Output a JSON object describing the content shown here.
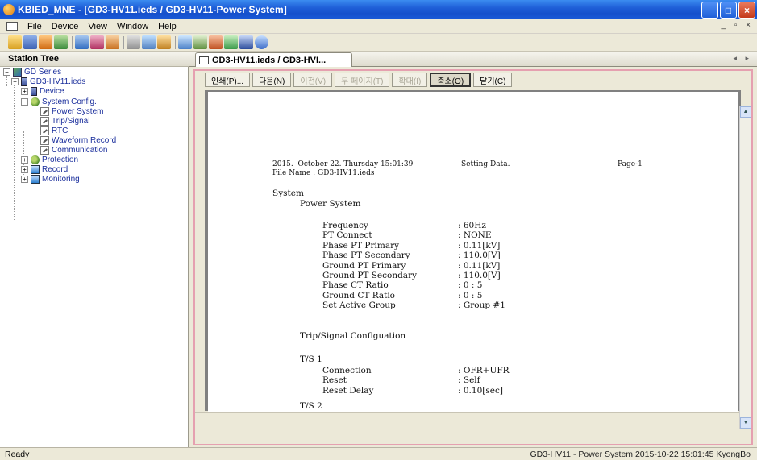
{
  "window": {
    "title": "KBIED_MNE - [GD3-HV11.ieds / GD3-HV11-Power System]",
    "controls": [
      "_",
      "□",
      "×"
    ]
  },
  "menu": {
    "items": [
      "File",
      "Device",
      "View",
      "Window",
      "Help"
    ],
    "mdi_controls": "_ ▫ ×"
  },
  "tree": {
    "header": "Station Tree",
    "nodes": {
      "root": "GD Series",
      "file": "GD3-HV11.ieds",
      "device": "Device",
      "system_config": "System Config.",
      "power_system": "Power System",
      "trip_signal": "Trip/Signal",
      "rtc": "RTC",
      "waveform": "Waveform Record",
      "communication": "Communication",
      "protection": "Protection",
      "record": "Record",
      "monitoring": "Monitoring"
    }
  },
  "tabs": {
    "active": "GD3-HV11.ieds / GD3-HVI...",
    "nav": "◂ ▸"
  },
  "print_toolbar": {
    "print": "인쇄(P)...",
    "next": "다음(N)",
    "prev": "이전(V)",
    "two_page": "두 페이지(T)",
    "zoom_in": "확대(I)",
    "zoom_out": "축소(O)",
    "close": "닫기(C)"
  },
  "report": {
    "header_date": "2015.  October 22. Thursday 15:01:39",
    "header_type": "Setting Data.",
    "header_page": "Page-1",
    "file_name": "File Name : GD3-HV11.ieds",
    "section": "System",
    "subsection_power": "Power System",
    "power_rows": [
      {
        "label": "Frequency",
        "value": ": 60Hz"
      },
      {
        "label": "PT Connect",
        "value": ": NONE"
      },
      {
        "label": "Phase PT Primary",
        "value": ": 0.11[kV]"
      },
      {
        "label": "Phase PT Secondary",
        "value": ": 110.0[V]"
      },
      {
        "label": "Ground PT Primary",
        "value": ": 0.11[kV]"
      },
      {
        "label": "Ground PT Secondary",
        "value": ": 110.0[V]"
      },
      {
        "label": "Phase CT Ratio",
        "value": ": 0 : 5"
      },
      {
        "label": "Ground CT Ratio",
        "value": ": 0 : 5"
      },
      {
        "label": "Set Active Group",
        "value": ": Group #1"
      }
    ],
    "subsection_trip": "Trip/Signal Configuation",
    "ts1_title": "T/S 1",
    "ts1_rows": [
      {
        "label": "Connection",
        "value": ": OFR+UFR"
      },
      {
        "label": "Reset",
        "value": ": Self"
      },
      {
        "label": "Reset Delay",
        "value": ": 0.10[sec]"
      }
    ],
    "ts2_title": "T/S 2"
  },
  "status": {
    "left": "Ready",
    "right": "GD3-HV11 - Power System  2015-10-22 15:01:45  KyongBo"
  }
}
